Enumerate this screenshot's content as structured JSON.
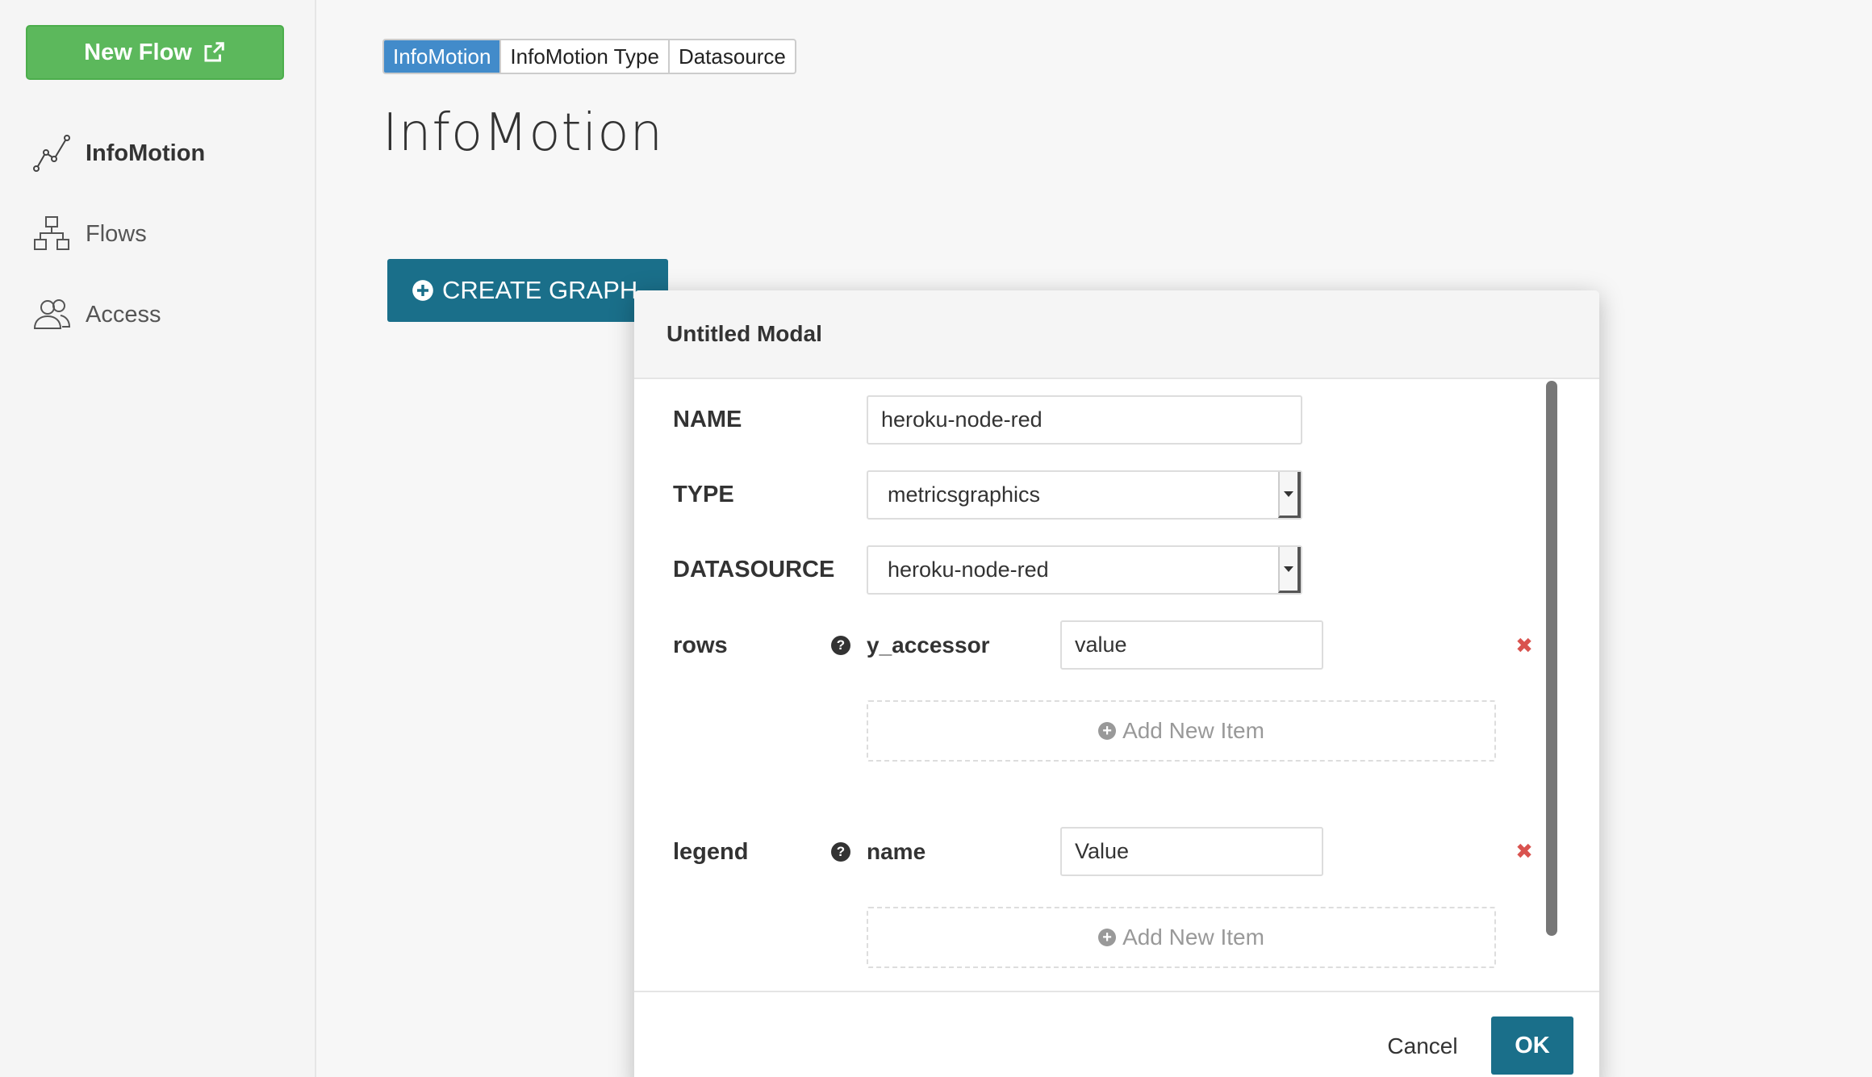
{
  "sidebar": {
    "new_flow_label": "New Flow",
    "items": [
      {
        "label": "InfoMotion",
        "icon": "line-chart-icon",
        "active": true
      },
      {
        "label": "Flows",
        "icon": "flows-icon",
        "active": false
      },
      {
        "label": "Access",
        "icon": "users-icon",
        "active": false
      }
    ]
  },
  "tabs": [
    {
      "label": "InfoMotion",
      "active": true
    },
    {
      "label": "InfoMotion Type",
      "active": false
    },
    {
      "label": "Datasource",
      "active": false
    }
  ],
  "page": {
    "title": "InfoMotion",
    "create_button": "CREATE GRAPH..."
  },
  "modal": {
    "title": "Untitled Modal",
    "name_label": "NAME",
    "name_value": "heroku-node-red",
    "type_label": "TYPE",
    "type_value": "metricsgraphics",
    "datasource_label": "DATASOURCE",
    "datasource_value": "heroku-node-red",
    "rows": {
      "label": "rows",
      "key": "y_accessor",
      "value": "value",
      "add_label": "Add New Item"
    },
    "legend": {
      "label": "legend",
      "key": "name",
      "value": "Value",
      "add_label": "Add New Item"
    },
    "cancel_label": "Cancel",
    "ok_label": "OK"
  },
  "colors": {
    "new_flow_green": "#5cb85c",
    "tab_active_blue": "#428bca",
    "primary_teal": "#1a6f8a",
    "remove_red": "#d9534f"
  }
}
